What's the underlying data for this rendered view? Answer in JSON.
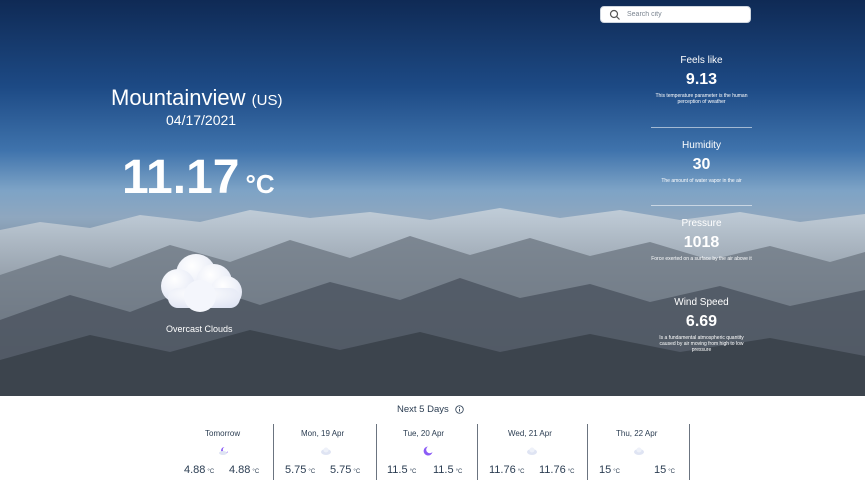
{
  "search": {
    "placeholder": "Search city"
  },
  "current": {
    "city": "Mountainview",
    "country": "(US)",
    "date": "04/17/2021",
    "temperature": "11.17",
    "unit": "°C",
    "condition": "Overcast Clouds",
    "condition_icon": "cloud-icon"
  },
  "details": [
    {
      "title": "Feels like",
      "value": "9.13",
      "description": "This temperature parameter is the human perception of weather"
    },
    {
      "title": "Humidity",
      "value": "30",
      "description": "The amount of water vapor in the air"
    },
    {
      "title": "Pressure",
      "value": "1018",
      "description": "Force exerted on a surface by the air above it"
    },
    {
      "title": "Wind Speed",
      "value": "6.69",
      "description": "Is a fundamental atmospheric quantity caused by air moving from high to low pressure"
    }
  ],
  "forecast": {
    "title": "Next 5 Days",
    "info_icon": "info-icon",
    "unit": "°C",
    "days": [
      {
        "name": "Tomorrow",
        "min": "4.88",
        "max": "4.88",
        "icon": "partly-cloudy-icon"
      },
      {
        "name": "Mon, 19 Apr",
        "min": "5.75",
        "max": "5.75",
        "icon": "cloud-icon"
      },
      {
        "name": "Tue, 20 Apr",
        "min": "11.5",
        "max": "11.5",
        "icon": "moon-icon"
      },
      {
        "name": "Wed, 21 Apr",
        "min": "11.76",
        "max": "11.76",
        "icon": "cloud-icon"
      },
      {
        "name": "Thu, 22 Apr",
        "min": "15",
        "max": "15",
        "icon": "cloud-icon"
      }
    ]
  },
  "colors": {
    "accent": "#8b5cf6",
    "text_dark": "#2b3d52"
  }
}
